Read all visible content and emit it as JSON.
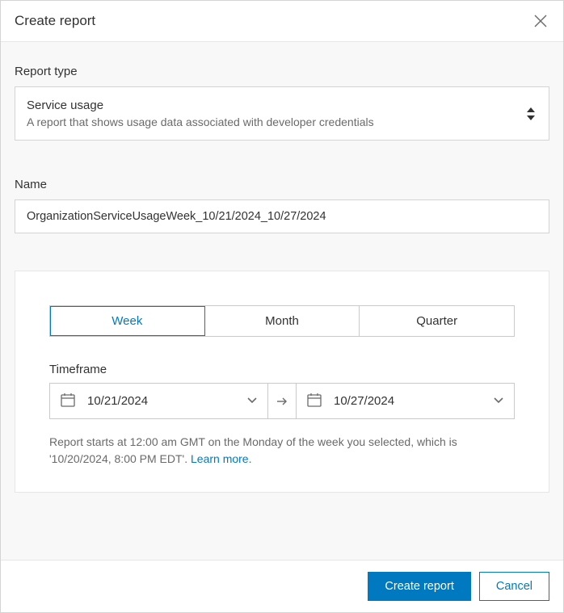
{
  "dialog": {
    "title": "Create report"
  },
  "reportType": {
    "label": "Report type",
    "selected": {
      "title": "Service usage",
      "description": "A report that shows usage data associated with developer credentials"
    }
  },
  "name": {
    "label": "Name",
    "value": "OrganizationServiceUsageWeek_10/21/2024_10/27/2024"
  },
  "period": {
    "tabs": [
      "Week",
      "Month",
      "Quarter"
    ],
    "active": "Week"
  },
  "timeframe": {
    "label": "Timeframe",
    "start": "10/21/2024",
    "end": "10/27/2024",
    "help_prefix": "Report starts at 12:00 am GMT on the Monday of the week you selected, which is '10/20/2024, 8:00 PM EDT'. ",
    "learn_more": "Learn more."
  },
  "footer": {
    "primary": "Create report",
    "secondary": "Cancel"
  }
}
